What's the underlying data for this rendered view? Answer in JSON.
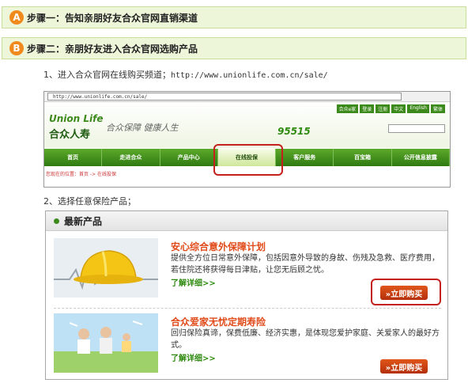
{
  "steps": [
    {
      "badge": "A",
      "text": "步骤一：告知亲朋好友合众官网直销渠道"
    },
    {
      "badge": "B",
      "text": "步骤二：亲朋好友进入合众官网选购产品"
    }
  ],
  "instruction1": {
    "text": "1、进入合众官网在线购买频道；",
    "url": "http://www.unionlife.com.cn/sale/"
  },
  "instruction2": {
    "text": "2、选择任意保险产品；"
  },
  "browser": {
    "address": "http://www.unionlife.com.cn/sale/",
    "logo_en": "Union Life",
    "logo_cn": "合众人寿",
    "slogan": "合众保障 健康人生",
    "phone": "95515",
    "top_links": [
      "合众e家",
      "登录",
      "注册",
      "中文",
      "English",
      "繁体"
    ],
    "nav": [
      "首页",
      "走进合众",
      "产品中心",
      "在线投保",
      "客户服务",
      "百宝箱",
      "公开信息披露"
    ],
    "active_nav": "在线投保",
    "breadcrumb": "您现在的位置：首页 -> 在线投保"
  },
  "panel": {
    "title": "最新产品",
    "products": [
      {
        "title": "安心综合意外保障计划",
        "desc": "提供全方位日常意外保障，包括因意外导致的身故、伤残及急救、医疗费用，若住院还将获得每日津贴，让您无后顾之忧。",
        "more": "了解详细>>",
        "buy": "»立即购买"
      },
      {
        "title": "合众爱家无忧定期寿险",
        "desc": "回归保险真谛，保费低廉、经济实惠，是体现您爱护家庭、关爱家人的最好方式。",
        "more": "了解详细>>",
        "buy": "»立即购买"
      }
    ]
  },
  "colors": {
    "accent_green": "#3d8a1c",
    "highlight_red": "#c6201c",
    "buy_orange": "#d0461a",
    "badge_orange": "#f08a1c"
  }
}
